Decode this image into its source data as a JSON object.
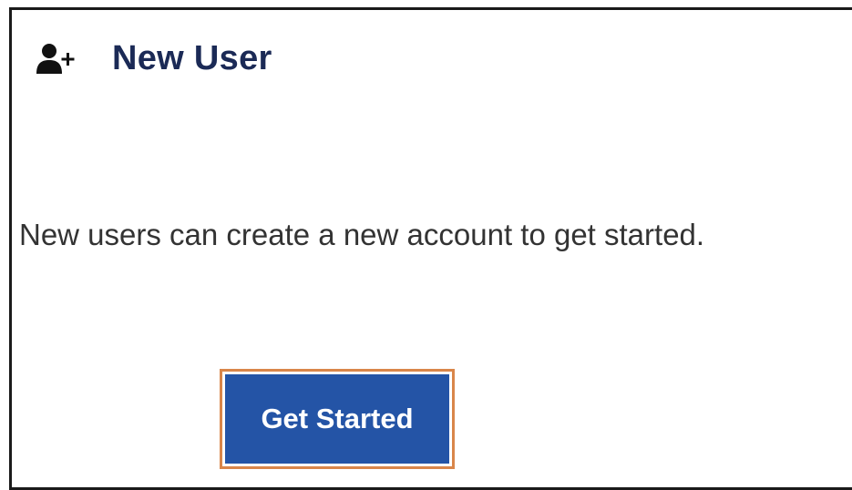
{
  "header": {
    "icon": "add-user-icon",
    "title": "New User"
  },
  "description": "New users can create a new account to get started.",
  "action": {
    "label": "Get Started"
  },
  "colors": {
    "title": "#1b2a56",
    "button_bg": "#2454a6",
    "button_focus_ring": "#d9864a",
    "text": "#333333"
  }
}
